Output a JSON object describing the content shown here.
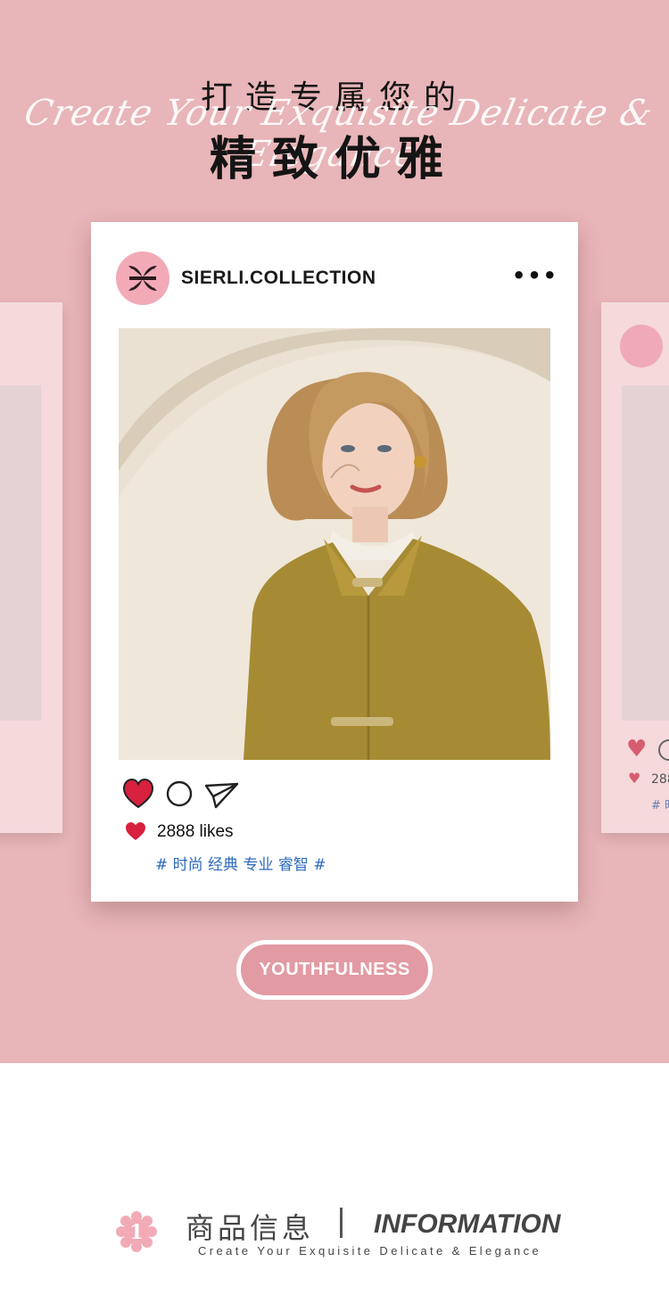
{
  "header": {
    "title_line1": "打造专属您的",
    "title_line2": "精致优雅",
    "script_text": "Create Your Exquisite Delicate & Elegance"
  },
  "post": {
    "handle": "SIERLI.COLLECTION",
    "more_icon": "more-dots-icon",
    "likes": "2888 likes",
    "tags": "# 时尚 经典 专业 睿智 #",
    "like_color": "#d8203f"
  },
  "side_card_right": {
    "likes_partial": "288",
    "tags_partial": "# 时"
  },
  "youth_button": {
    "label": "YOUTHFULNESS"
  },
  "info": {
    "number": "1",
    "title_cn": "商品信息",
    "title_en": "INFORMATION",
    "subtitle": "Create Your Exquisite Delicate & Elegance"
  },
  "colors": {
    "hero_bg": "#e8b5b8",
    "accent_pink": "#f2aab7",
    "tag_blue": "#2d6abf"
  }
}
